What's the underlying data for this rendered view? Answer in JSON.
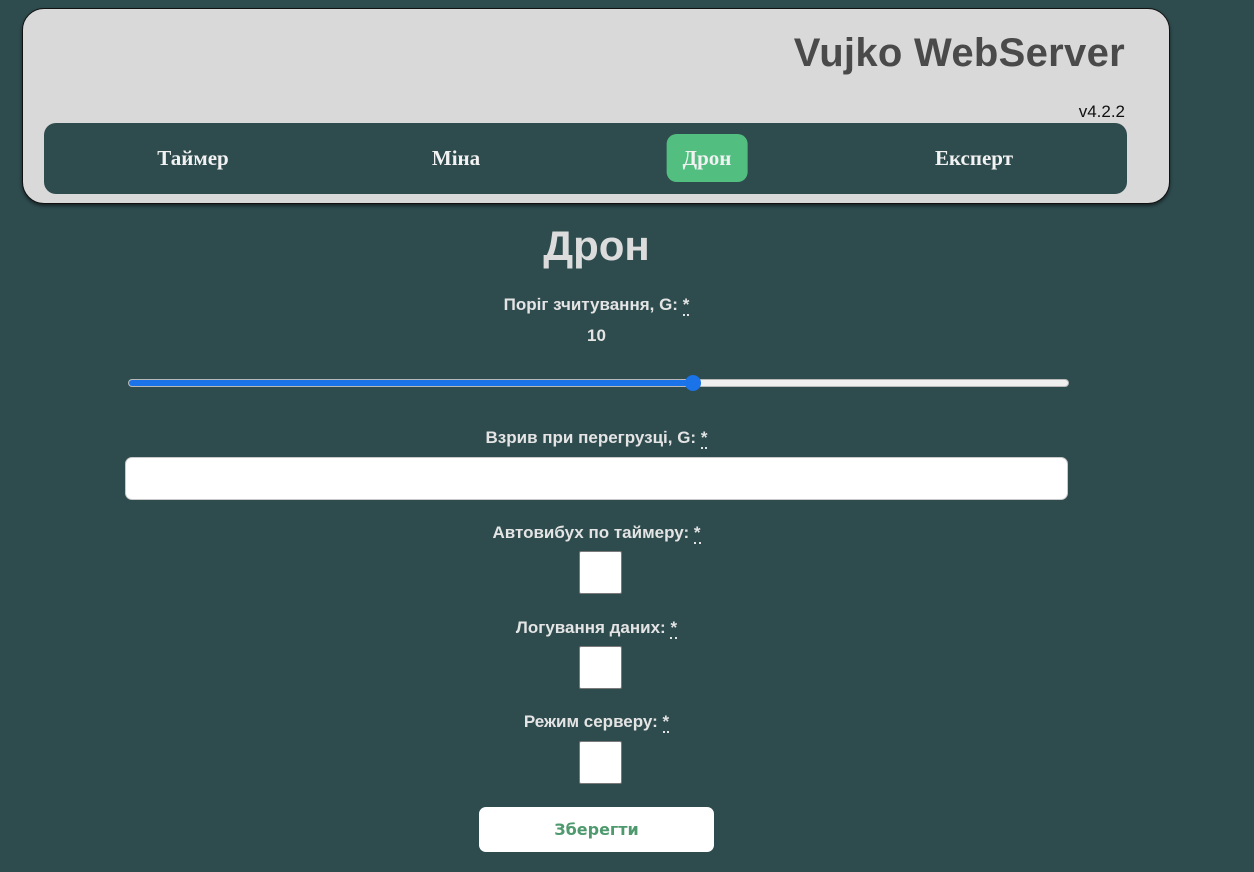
{
  "header": {
    "title": "Vujko WebServer",
    "version": "v4.2.2"
  },
  "nav": {
    "items": [
      {
        "label": "Таймер",
        "active": false
      },
      {
        "label": "Міна",
        "active": false
      },
      {
        "label": "Дрон",
        "active": true
      },
      {
        "label": "Експерт",
        "active": false
      }
    ]
  },
  "page": {
    "title": "Дрон"
  },
  "form": {
    "required_mark": "*",
    "threshold": {
      "label": "Поріг зчитування, G:",
      "value": "10",
      "fill_fraction": 0.6
    },
    "overload": {
      "label": "Взрив при перегрузці, G:",
      "value": ""
    },
    "auto_explode": {
      "label": "Автовибух по таймеру:",
      "checked": false
    },
    "logging": {
      "label": "Логування даних:",
      "checked": false
    },
    "server_mode": {
      "label": "Режим серверу:",
      "checked": false
    },
    "save_label": "Зберегти"
  },
  "colors": {
    "background": "#2e4b4e",
    "header_bg": "#d9d9d9",
    "nav_active": "#52be80",
    "slider_accent": "#1a73e8",
    "save_text": "#4e9a6e"
  }
}
